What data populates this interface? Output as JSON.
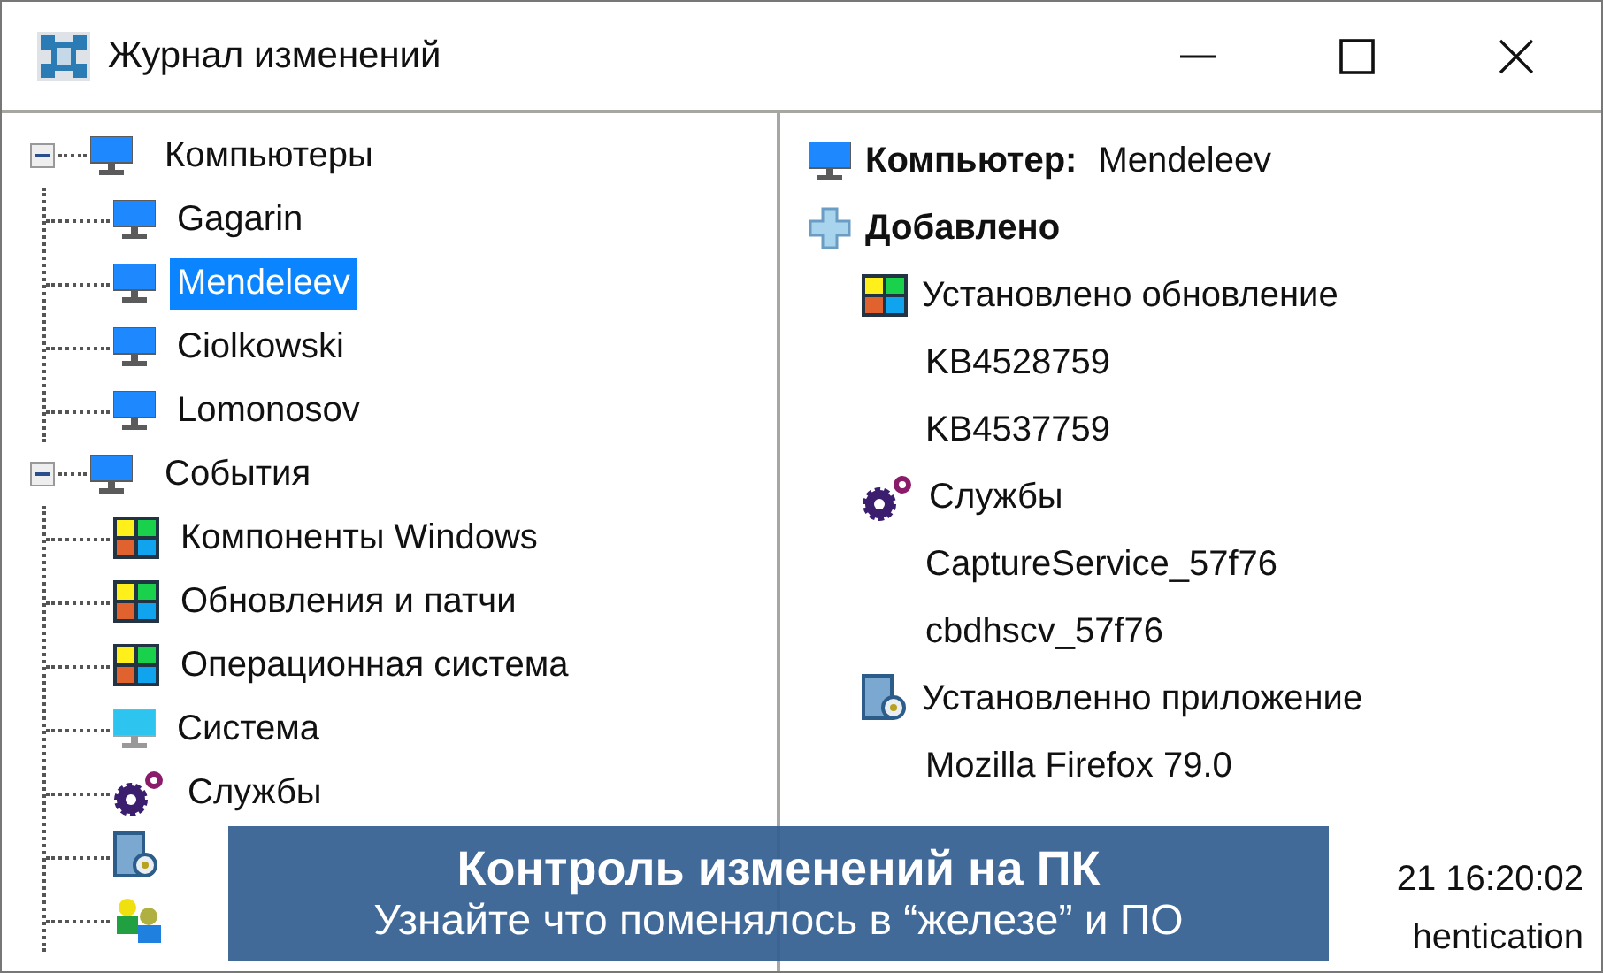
{
  "window": {
    "title": "Журнал изменений"
  },
  "tree": [
    {
      "label": "Компьютеры",
      "kind": "monitor",
      "expanded": true,
      "selected": false,
      "children": [
        {
          "label": "Gagarin",
          "kind": "monitor",
          "selected": false
        },
        {
          "label": "Mendeleev",
          "kind": "monitor",
          "selected": true
        },
        {
          "label": "Ciolkowski",
          "kind": "monitor",
          "selected": false
        },
        {
          "label": "Lomonosov",
          "kind": "monitor",
          "selected": false
        }
      ]
    },
    {
      "label": "События",
      "kind": "monitor",
      "expanded": true,
      "selected": false,
      "children": [
        {
          "label": "Компоненты Windows",
          "kind": "tiles",
          "selected": false
        },
        {
          "label": "Обновления и патчи",
          "kind": "tiles",
          "selected": false
        },
        {
          "label": "Операционная система",
          "kind": "tiles",
          "selected": false
        },
        {
          "label": "Система",
          "kind": "screen",
          "selected": false
        },
        {
          "label": "Службы",
          "kind": "gears",
          "selected": false
        },
        {
          "kind": "app"
        },
        {
          "kind": "users"
        }
      ]
    }
  ],
  "details": {
    "computer_label": "Компьютер:",
    "computer_name": "Mendeleev",
    "section": "Добавлено",
    "groups": [
      {
        "label": "Установлено обновление",
        "kind": "tiles",
        "children": [
          "KB4528759",
          "KB4537759"
        ]
      },
      {
        "label": "Службы",
        "kind": "gears",
        "children": [
          "CaptureService_57f76",
          "cbdhscv_57f76"
        ]
      },
      {
        "label": "Установленно приложение",
        "kind": "app",
        "children": [
          "Mozilla Firefox 79.0"
        ]
      }
    ],
    "trailing": [
      "21 16:20:02",
      "hentication"
    ]
  },
  "banner": {
    "title": "Контроль изменений на ПК",
    "subtitle": "Узнайте что поменялось в “железе” и ПО"
  }
}
